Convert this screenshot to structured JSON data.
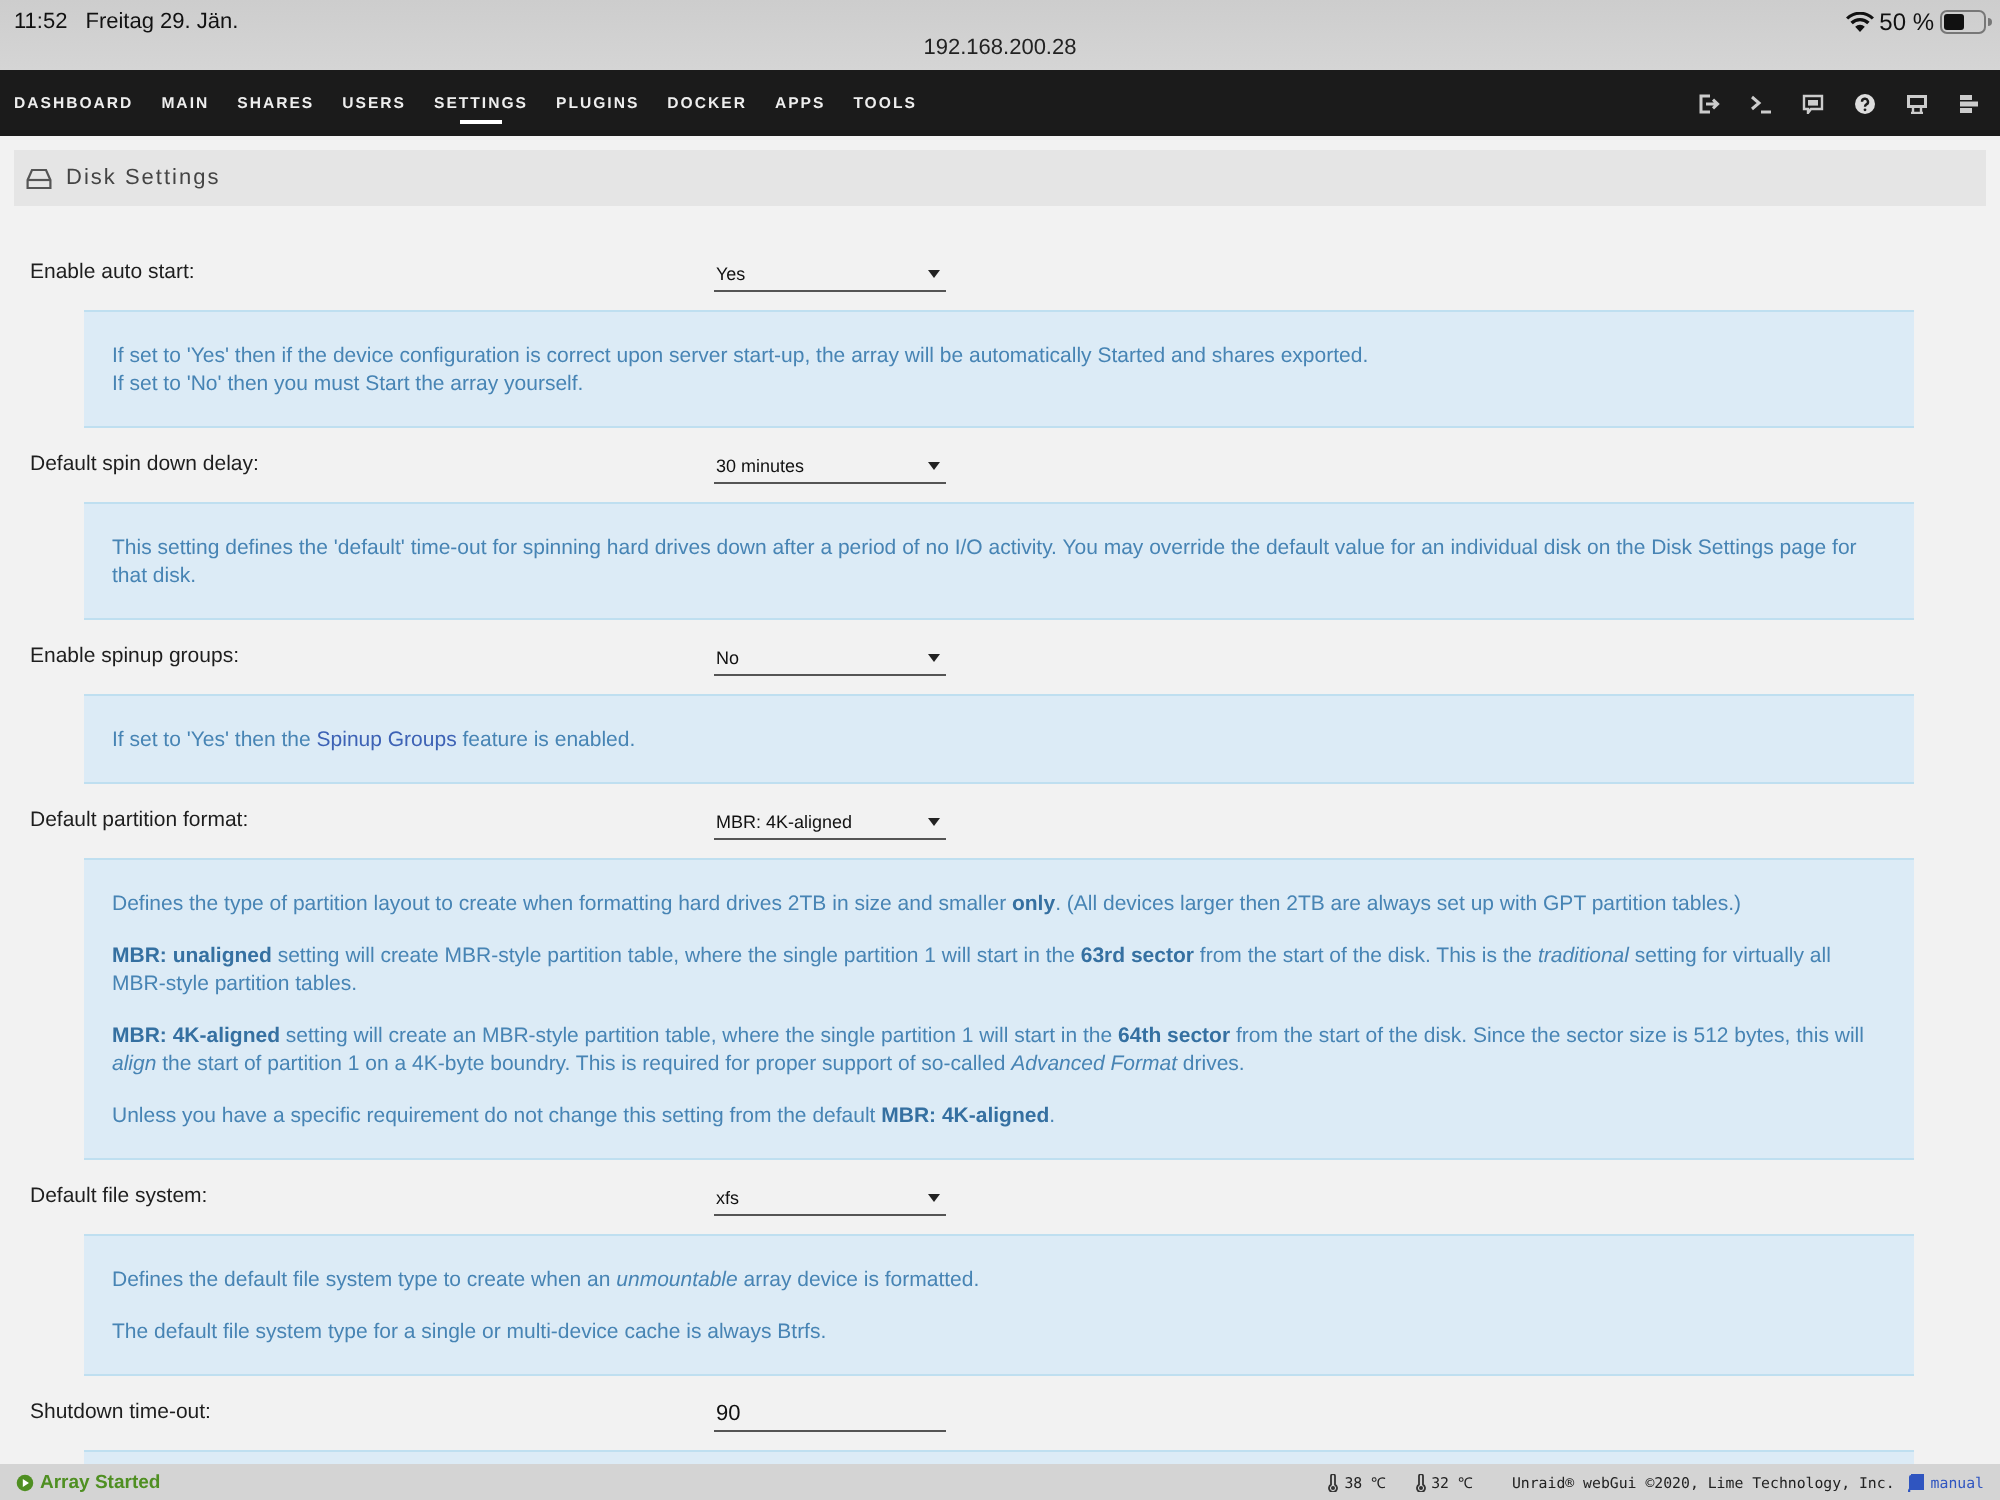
{
  "device_status": {
    "time": "11:52",
    "date": "Freitag 29. Jän.",
    "battery": "50 %"
  },
  "address_bar": {
    "url": "192.168.200.28"
  },
  "nav": {
    "tabs": [
      {
        "label": "DASHBOARD",
        "selected": false
      },
      {
        "label": "MAIN",
        "selected": false
      },
      {
        "label": "SHARES",
        "selected": false
      },
      {
        "label": "USERS",
        "selected": false
      },
      {
        "label": "SETTINGS",
        "selected": true
      },
      {
        "label": "PLUGINS",
        "selected": false
      },
      {
        "label": "DOCKER",
        "selected": false
      },
      {
        "label": "APPS",
        "selected": false
      },
      {
        "label": "TOOLS",
        "selected": false
      }
    ]
  },
  "page_title": "Disk Settings",
  "settings": [
    {
      "label": "Enable auto start:",
      "kind": "select",
      "value": "Yes",
      "help": [
        "If set to 'Yes' then if the device configuration is correct upon server start-up, the array will be automatically Started and shares exported.\nIf set to 'No' then you must Start the array yourself."
      ]
    },
    {
      "label": "Default spin down delay:",
      "kind": "select",
      "value": "30 minutes",
      "help": [
        "This setting defines the 'default' time-out for spinning hard drives down after a period of no I/O activity. You may override the default value for an individual disk on the Disk Settings page for that disk."
      ]
    },
    {
      "label": "Enable spinup groups:",
      "kind": "select",
      "value": "No",
      "help": [
        {
          "before": "If set to 'Yes' then the ",
          "link": "Spinup Groups",
          "after": " feature is enabled."
        }
      ]
    },
    {
      "label": "Default partition format:",
      "kind": "select",
      "value": "MBR: 4K-aligned",
      "help": [
        "Defines the type of partition layout to create when formatting hard drives 2TB in size and smaller **only**. (All devices larger then 2TB are always set up with GPT partition tables.)",
        "**MBR: unaligned** setting will create MBR-style partition table, where the single partition 1 will start in the **63rd sector** from the start of the disk. This is the *traditional* setting for virtually all MBR-style partition tables.",
        "**MBR: 4K-aligned** setting will create an MBR-style partition table, where the single partition 1 will start in the **64th sector** from the start of the disk. Since the sector size is 512 bytes, this will *align* the start of partition 1 on a 4K-byte boundry. This is required for proper support of so-called *Advanced Format* drives.",
        "Unless you have a specific requirement do not change this setting from the default **MBR: 4K-aligned**."
      ]
    },
    {
      "label": "Default file system:",
      "kind": "select",
      "value": "xfs",
      "help": [
        "Defines the default file system type to create when an *unmountable* array device is formatted.",
        "The default file system type for a single or multi-device cache is always Btrfs."
      ]
    },
    {
      "label": "Shutdown time-out:",
      "kind": "input",
      "value": "90",
      "help_box": true
    }
  ],
  "footer": {
    "array_status": "Array Started",
    "temperatures": [
      "38 ℃",
      "32 ℃"
    ],
    "copyright": "Unraid® webGui ©2020, Lime Technology, Inc.",
    "manual_link": "manual"
  }
}
